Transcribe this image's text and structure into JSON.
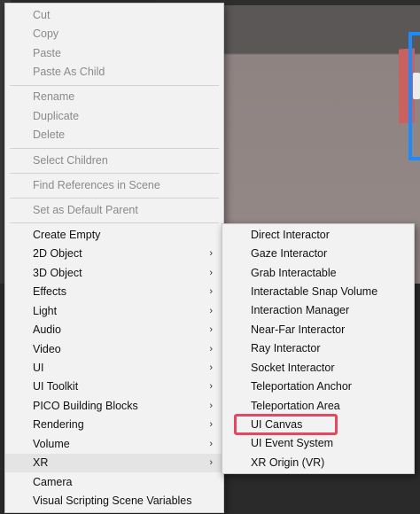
{
  "main_menu": {
    "cut": "Cut",
    "copy": "Copy",
    "paste": "Paste",
    "paste_as_child": "Paste As Child",
    "rename": "Rename",
    "duplicate": "Duplicate",
    "delete": "Delete",
    "select_children": "Select Children",
    "find_references": "Find References in Scene",
    "set_default_parent": "Set as Default Parent",
    "create_empty": "Create Empty",
    "object_2d": "2D Object",
    "object_3d": "3D Object",
    "effects": "Effects",
    "light": "Light",
    "audio": "Audio",
    "video": "Video",
    "ui": "UI",
    "ui_toolkit": "UI Toolkit",
    "pico_building_blocks": "PICO Building Blocks",
    "rendering": "Rendering",
    "volume": "Volume",
    "xr": "XR",
    "camera": "Camera",
    "visual_scripting": "Visual Scripting Scene Variables",
    "submenu_arrow": "›"
  },
  "xr_submenu": {
    "direct_interactor": "Direct Interactor",
    "gaze_interactor": "Gaze Interactor",
    "grab_interactable": "Grab Interactable",
    "interactable_snap_volume": "Interactable Snap Volume",
    "interaction_manager": "Interaction Manager",
    "near_far_interactor": "Near-Far Interactor",
    "ray_interactor": "Ray Interactor",
    "socket_interactor": "Socket Interactor",
    "teleportation_anchor": "Teleportation Anchor",
    "teleportation_area": "Teleportation Area",
    "ui_canvas": "UI Canvas",
    "ui_event_system": "UI Event System",
    "xr_origin": "XR Origin (VR)"
  },
  "colors": {
    "highlight": "#e2485f",
    "selection_outline": "#1a8cff"
  }
}
